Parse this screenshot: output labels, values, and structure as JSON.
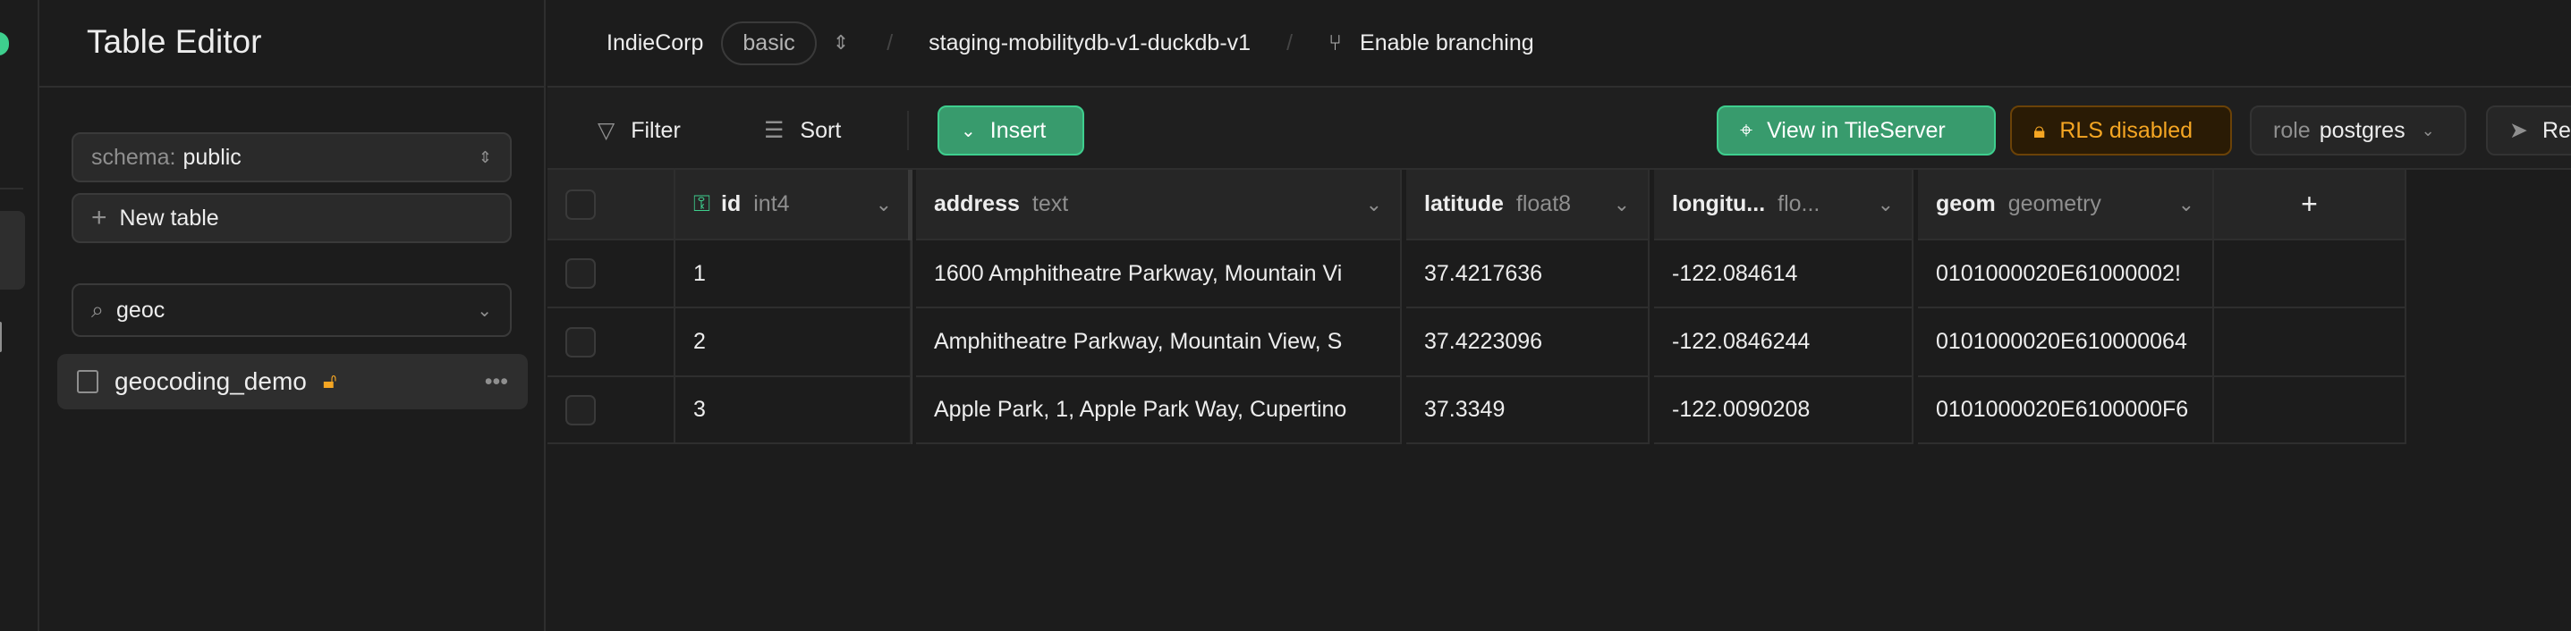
{
  "sidebar": {
    "title": "Table Editor",
    "schema_label": "schema:",
    "schema_value": "public",
    "new_table": "New table",
    "search_value": "geoc",
    "tables": [
      {
        "name": "geocoding_demo",
        "rls_icon": "unlock-icon"
      }
    ]
  },
  "breadcrumb": {
    "org": "IndieCorp",
    "plan": "basic",
    "project": "staging-mobilitydb-v1-duckdb-v1",
    "branching": "Enable branching"
  },
  "toolbar": {
    "filter": "Filter",
    "sort": "Sort",
    "insert": "Insert",
    "tileserver": "View in TileServer",
    "rls": "RLS disabled",
    "role_label": "role",
    "role_value": "postgres",
    "realtime": "Re"
  },
  "colors": {
    "brand": "#3ecf8e",
    "warning": "#f5a623",
    "background": "#1c1c1c"
  },
  "table": {
    "columns": [
      {
        "name": "id",
        "type": "int4",
        "primary_key": true
      },
      {
        "name": "address",
        "type": "text"
      },
      {
        "name": "latitude",
        "type": "float8"
      },
      {
        "name": "longitu...",
        "type": "flo..."
      },
      {
        "name": "geom",
        "type": "geometry"
      }
    ],
    "rows": [
      [
        "1",
        "1600 Amphitheatre Parkway, Mountain Vi",
        "37.4217636",
        "-122.084614",
        "0101000020E61000002!"
      ],
      [
        "2",
        "Amphitheatre Parkway, Mountain View, S",
        "37.4223096",
        "-122.0846244",
        "0101000020E610000064"
      ],
      [
        "3",
        "Apple Park, 1, Apple Park Way, Cupertino",
        "37.3349",
        "-122.0090208",
        "0101000020E6100000F6"
      ]
    ]
  }
}
